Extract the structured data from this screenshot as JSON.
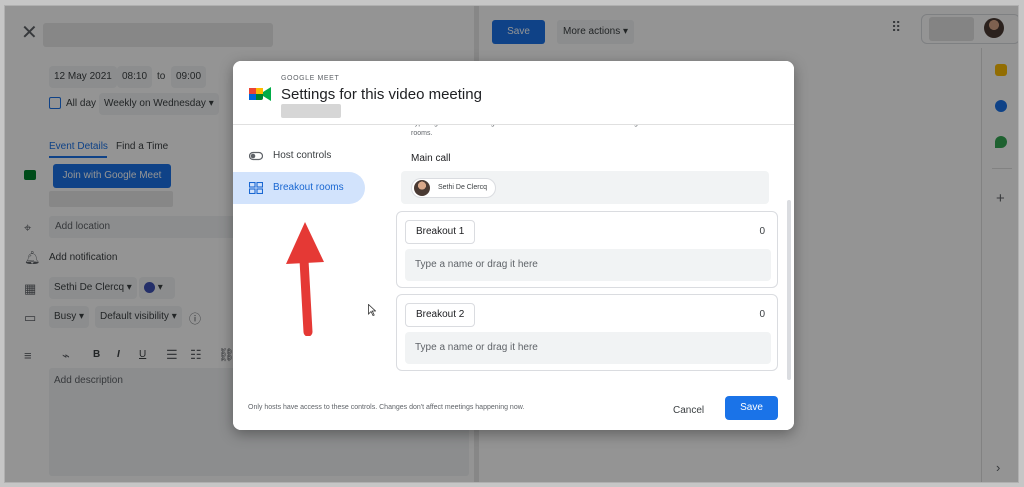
{
  "editor": {
    "close_icon": "close-icon",
    "date": "12 May 2021",
    "start_time": "08:10",
    "to_label": "to",
    "end_time": "09:00",
    "all_day_label": "All day",
    "recurrence": "Weekly on Wednesday",
    "tabs": [
      "Event Details",
      "Find a Time"
    ],
    "join_button": "Join with Google Meet",
    "location_placeholder": "Add location",
    "notification_label": "Add notification",
    "calendar_owner": "Sethi De Clercq",
    "busy_status": "Busy",
    "visibility": "Default visibility",
    "format_buttons": [
      "B",
      "I",
      "U"
    ],
    "description_placeholder": "Add description"
  },
  "topbar": {
    "save_label": "Save",
    "more_actions_label": "More actions"
  },
  "dialog": {
    "kicker": "GOOGLE MEET",
    "title": "Settings for this video meeting",
    "nav": [
      {
        "label": "Host controls",
        "icon": "toggle-icon"
      },
      {
        "label": "Breakout rooms",
        "icon": "grid-icon",
        "active": true
      }
    ],
    "intro_text": "Type a guest name or drag it to move it between breakout rooms. Invite guests in Calendar to add them to breakout rooms.",
    "main_call_label": "Main call",
    "main_call_participant": "Sethi De Clercq",
    "rooms": [
      {
        "name": "Breakout 1",
        "count": "0",
        "placeholder": "Type a name or drag it here"
      },
      {
        "name": "Breakout 2",
        "count": "0",
        "placeholder": "Type a name or drag it here"
      }
    ],
    "footer_note": "Only hosts have access to these controls. Changes don't affect meetings happening now.",
    "cancel_label": "Cancel",
    "save_label": "Save"
  },
  "colors": {
    "accent": "#1a73e8",
    "active_nav_bg": "#d2e3fc",
    "annotation_arrow": "#e53935"
  }
}
